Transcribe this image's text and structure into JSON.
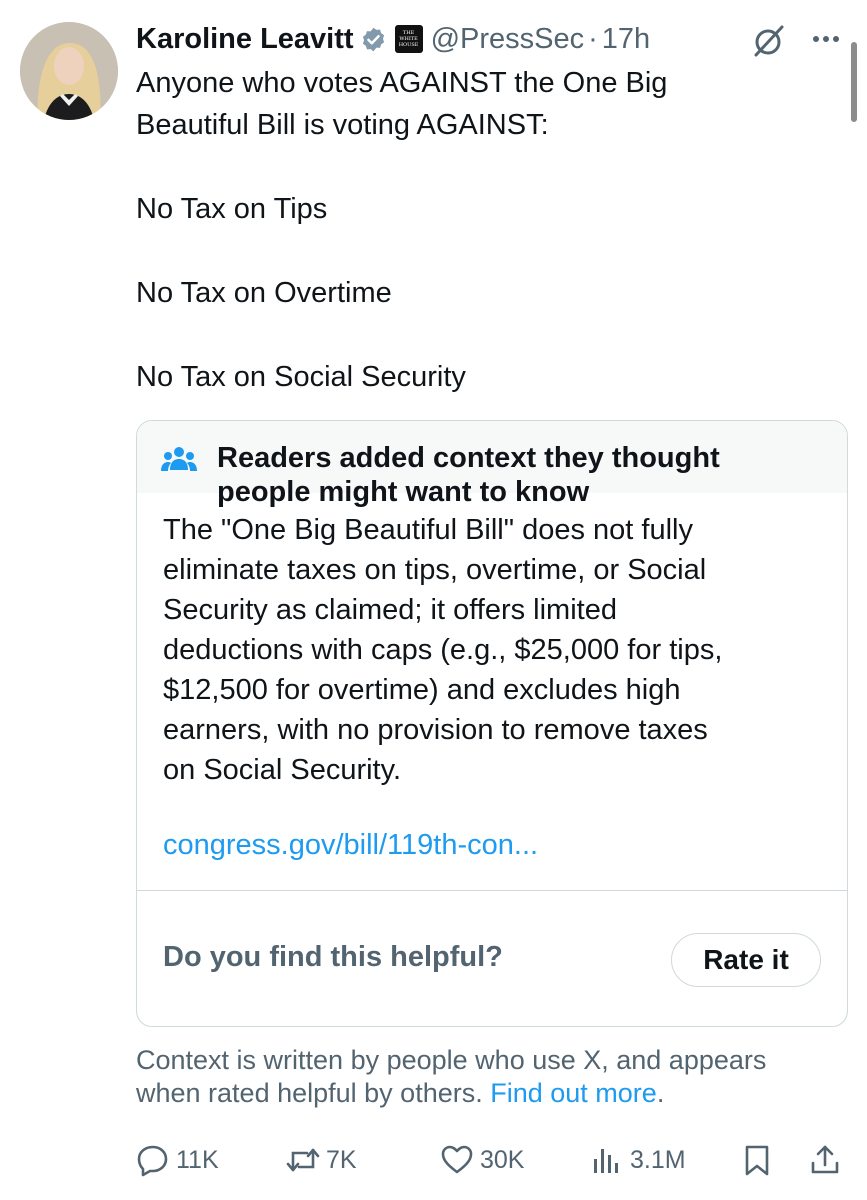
{
  "author": {
    "name": "Karoline Leavitt",
    "handle": "@PressSec",
    "time": "17h",
    "separator": "·",
    "affiliation_badge": [
      "THE",
      "WHITE",
      "HOUSE"
    ]
  },
  "tweet": {
    "lines": [
      "Anyone who votes AGAINST the One Big",
      "Beautiful Bill is voting AGAINST:",
      "No Tax on Tips",
      "No Tax on Overtime",
      "No Tax on Social Security"
    ]
  },
  "community_note": {
    "title_line1": "Readers added context they thought",
    "title_line2": "people might want to know",
    "body_lines": [
      "The \"One Big Beautiful Bill\" does not fully",
      "eliminate taxes on tips, overtime, or Social",
      "Security as claimed; it offers limited",
      "deductions with caps (e.g., $25,000 for tips,",
      "$12,500 for overtime) and excludes high",
      "earners, with no provision to remove taxes",
      "on Social Security."
    ],
    "link": "congress.gov/bill/119th-con...",
    "helpful_question": "Do you find this helpful?",
    "rate_button": "Rate it"
  },
  "context_footer": {
    "line1": "Context is written by people who use X, and appears",
    "line2_text": "when rated helpful by others.",
    "find_out_more": "Find out more",
    "period": "."
  },
  "actions": {
    "replies": "11K",
    "reposts": "7K",
    "likes": "30K",
    "views": "3.1M"
  },
  "icons": [
    "verified-badge-icon",
    "grok-icon",
    "more-icon",
    "people-icon",
    "reply-icon",
    "repost-icon",
    "like-icon",
    "views-icon",
    "bookmark-icon",
    "share-icon"
  ],
  "colors": {
    "text_primary": "#0f1419",
    "text_secondary": "#536471",
    "link_blue": "#1d9bf0",
    "border": "#cfd9de",
    "note_header_bg": "#f7f9f9",
    "verified_gray": "#829aab"
  }
}
